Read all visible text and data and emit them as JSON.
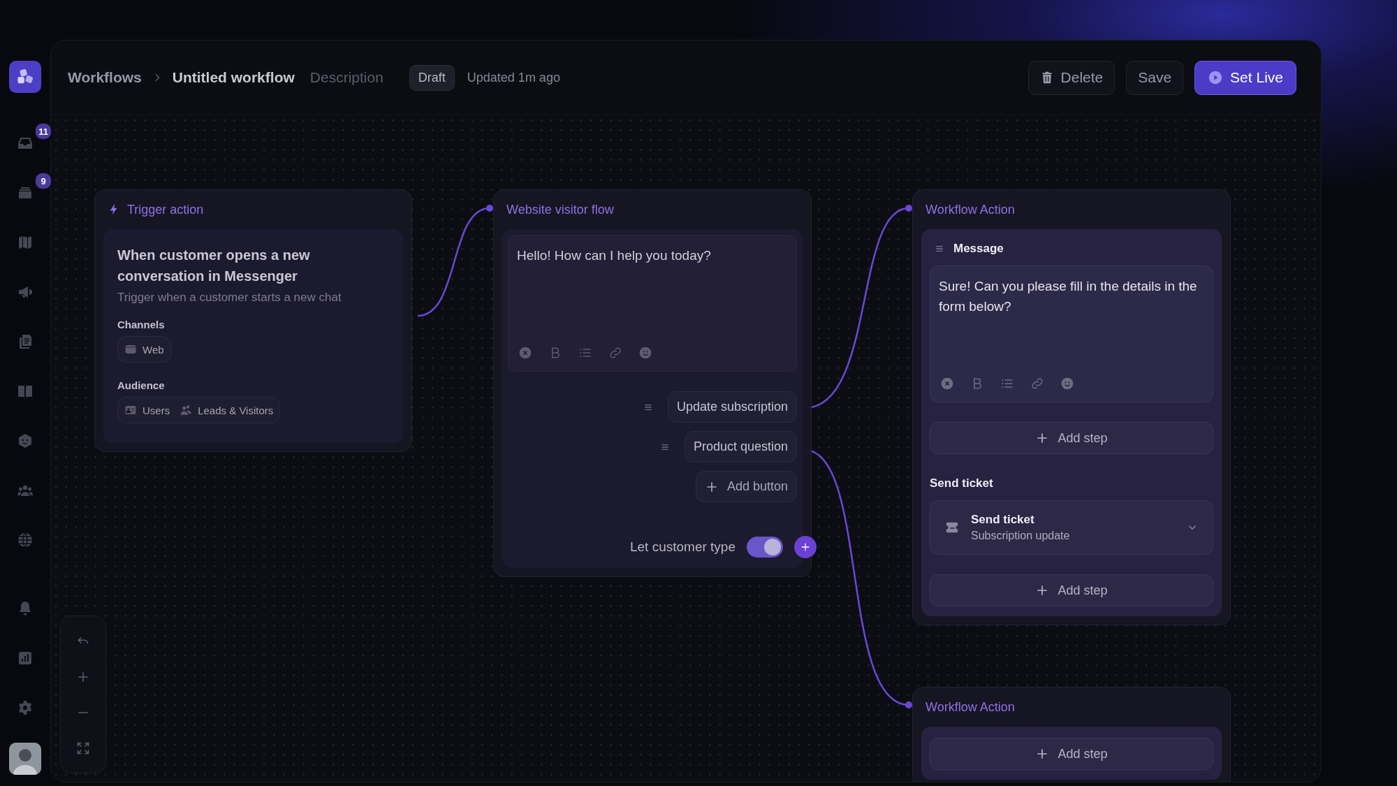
{
  "sidebar": {
    "badges": [
      "11",
      "9"
    ]
  },
  "header": {
    "breadcrumb": [
      "Workflows",
      "Untitled workflow"
    ],
    "description": {
      "placeholder": "Description"
    },
    "status": "Draft",
    "updated": "Updated 1m ago",
    "buttons": [
      {
        "label": "Delete",
        "kind": "delete"
      },
      {
        "label": "Save",
        "kind": "plain"
      },
      {
        "label": "Set Live",
        "kind": "primary"
      }
    ]
  },
  "trigger": {
    "header": "Trigger action",
    "title": "When customer opens a new conversation in Messenger",
    "subtitle": "Trigger when a customer starts a new chat",
    "channels_label": "Channels",
    "channels": [
      "Web"
    ],
    "audience_label": "Audience",
    "audience": [
      "Users",
      "Leads & Visitors"
    ]
  },
  "visitor_flow": {
    "header": "Website visitor flow",
    "message": "Hello! How can I help you today?",
    "reply_buttons": [
      "Update subscription",
      "Product question"
    ],
    "add_button": "Add button",
    "toggle": {
      "label": "Let customer type",
      "on": true
    }
  },
  "actions": [
    {
      "header": "Workflow Action",
      "steps": [
        {
          "kind": "message",
          "label": "Message",
          "text": "Sure! Can you please fill in the details in the form below?"
        },
        {
          "kind": "add",
          "label": "Add step"
        },
        {
          "kind": "section",
          "label": "Send ticket"
        },
        {
          "kind": "ticket",
          "title": "Send ticket",
          "subtitle": "Subscription update"
        },
        {
          "kind": "add",
          "label": "Add step"
        }
      ]
    },
    {
      "header": "Workflow Action",
      "steps": [
        {
          "kind": "add",
          "label": "Add step"
        }
      ]
    }
  ]
}
